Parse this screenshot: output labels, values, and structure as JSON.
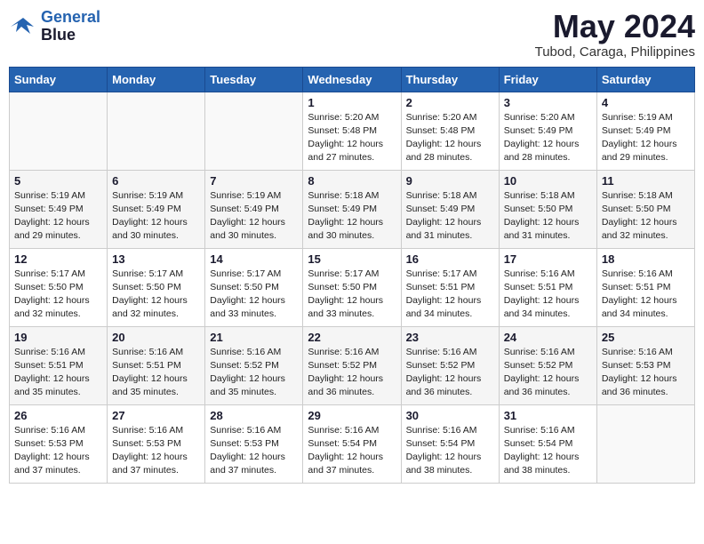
{
  "header": {
    "logo_line1": "General",
    "logo_line2": "Blue",
    "title": "May 2024",
    "subtitle": "Tubod, Caraga, Philippines"
  },
  "weekdays": [
    "Sunday",
    "Monday",
    "Tuesday",
    "Wednesday",
    "Thursday",
    "Friday",
    "Saturday"
  ],
  "weeks": [
    [
      {
        "day": "",
        "info": ""
      },
      {
        "day": "",
        "info": ""
      },
      {
        "day": "",
        "info": ""
      },
      {
        "day": "1",
        "info": "Sunrise: 5:20 AM\nSunset: 5:48 PM\nDaylight: 12 hours\nand 27 minutes."
      },
      {
        "day": "2",
        "info": "Sunrise: 5:20 AM\nSunset: 5:48 PM\nDaylight: 12 hours\nand 28 minutes."
      },
      {
        "day": "3",
        "info": "Sunrise: 5:20 AM\nSunset: 5:49 PM\nDaylight: 12 hours\nand 28 minutes."
      },
      {
        "day": "4",
        "info": "Sunrise: 5:19 AM\nSunset: 5:49 PM\nDaylight: 12 hours\nand 29 minutes."
      }
    ],
    [
      {
        "day": "5",
        "info": "Sunrise: 5:19 AM\nSunset: 5:49 PM\nDaylight: 12 hours\nand 29 minutes."
      },
      {
        "day": "6",
        "info": "Sunrise: 5:19 AM\nSunset: 5:49 PM\nDaylight: 12 hours\nand 30 minutes."
      },
      {
        "day": "7",
        "info": "Sunrise: 5:19 AM\nSunset: 5:49 PM\nDaylight: 12 hours\nand 30 minutes."
      },
      {
        "day": "8",
        "info": "Sunrise: 5:18 AM\nSunset: 5:49 PM\nDaylight: 12 hours\nand 30 minutes."
      },
      {
        "day": "9",
        "info": "Sunrise: 5:18 AM\nSunset: 5:49 PM\nDaylight: 12 hours\nand 31 minutes."
      },
      {
        "day": "10",
        "info": "Sunrise: 5:18 AM\nSunset: 5:50 PM\nDaylight: 12 hours\nand 31 minutes."
      },
      {
        "day": "11",
        "info": "Sunrise: 5:18 AM\nSunset: 5:50 PM\nDaylight: 12 hours\nand 32 minutes."
      }
    ],
    [
      {
        "day": "12",
        "info": "Sunrise: 5:17 AM\nSunset: 5:50 PM\nDaylight: 12 hours\nand 32 minutes."
      },
      {
        "day": "13",
        "info": "Sunrise: 5:17 AM\nSunset: 5:50 PM\nDaylight: 12 hours\nand 32 minutes."
      },
      {
        "day": "14",
        "info": "Sunrise: 5:17 AM\nSunset: 5:50 PM\nDaylight: 12 hours\nand 33 minutes."
      },
      {
        "day": "15",
        "info": "Sunrise: 5:17 AM\nSunset: 5:50 PM\nDaylight: 12 hours\nand 33 minutes."
      },
      {
        "day": "16",
        "info": "Sunrise: 5:17 AM\nSunset: 5:51 PM\nDaylight: 12 hours\nand 34 minutes."
      },
      {
        "day": "17",
        "info": "Sunrise: 5:16 AM\nSunset: 5:51 PM\nDaylight: 12 hours\nand 34 minutes."
      },
      {
        "day": "18",
        "info": "Sunrise: 5:16 AM\nSunset: 5:51 PM\nDaylight: 12 hours\nand 34 minutes."
      }
    ],
    [
      {
        "day": "19",
        "info": "Sunrise: 5:16 AM\nSunset: 5:51 PM\nDaylight: 12 hours\nand 35 minutes."
      },
      {
        "day": "20",
        "info": "Sunrise: 5:16 AM\nSunset: 5:51 PM\nDaylight: 12 hours\nand 35 minutes."
      },
      {
        "day": "21",
        "info": "Sunrise: 5:16 AM\nSunset: 5:52 PM\nDaylight: 12 hours\nand 35 minutes."
      },
      {
        "day": "22",
        "info": "Sunrise: 5:16 AM\nSunset: 5:52 PM\nDaylight: 12 hours\nand 36 minutes."
      },
      {
        "day": "23",
        "info": "Sunrise: 5:16 AM\nSunset: 5:52 PM\nDaylight: 12 hours\nand 36 minutes."
      },
      {
        "day": "24",
        "info": "Sunrise: 5:16 AM\nSunset: 5:52 PM\nDaylight: 12 hours\nand 36 minutes."
      },
      {
        "day": "25",
        "info": "Sunrise: 5:16 AM\nSunset: 5:53 PM\nDaylight: 12 hours\nand 36 minutes."
      }
    ],
    [
      {
        "day": "26",
        "info": "Sunrise: 5:16 AM\nSunset: 5:53 PM\nDaylight: 12 hours\nand 37 minutes."
      },
      {
        "day": "27",
        "info": "Sunrise: 5:16 AM\nSunset: 5:53 PM\nDaylight: 12 hours\nand 37 minutes."
      },
      {
        "day": "28",
        "info": "Sunrise: 5:16 AM\nSunset: 5:53 PM\nDaylight: 12 hours\nand 37 minutes."
      },
      {
        "day": "29",
        "info": "Sunrise: 5:16 AM\nSunset: 5:54 PM\nDaylight: 12 hours\nand 37 minutes."
      },
      {
        "day": "30",
        "info": "Sunrise: 5:16 AM\nSunset: 5:54 PM\nDaylight: 12 hours\nand 38 minutes."
      },
      {
        "day": "31",
        "info": "Sunrise: 5:16 AM\nSunset: 5:54 PM\nDaylight: 12 hours\nand 38 minutes."
      },
      {
        "day": "",
        "info": ""
      }
    ]
  ]
}
